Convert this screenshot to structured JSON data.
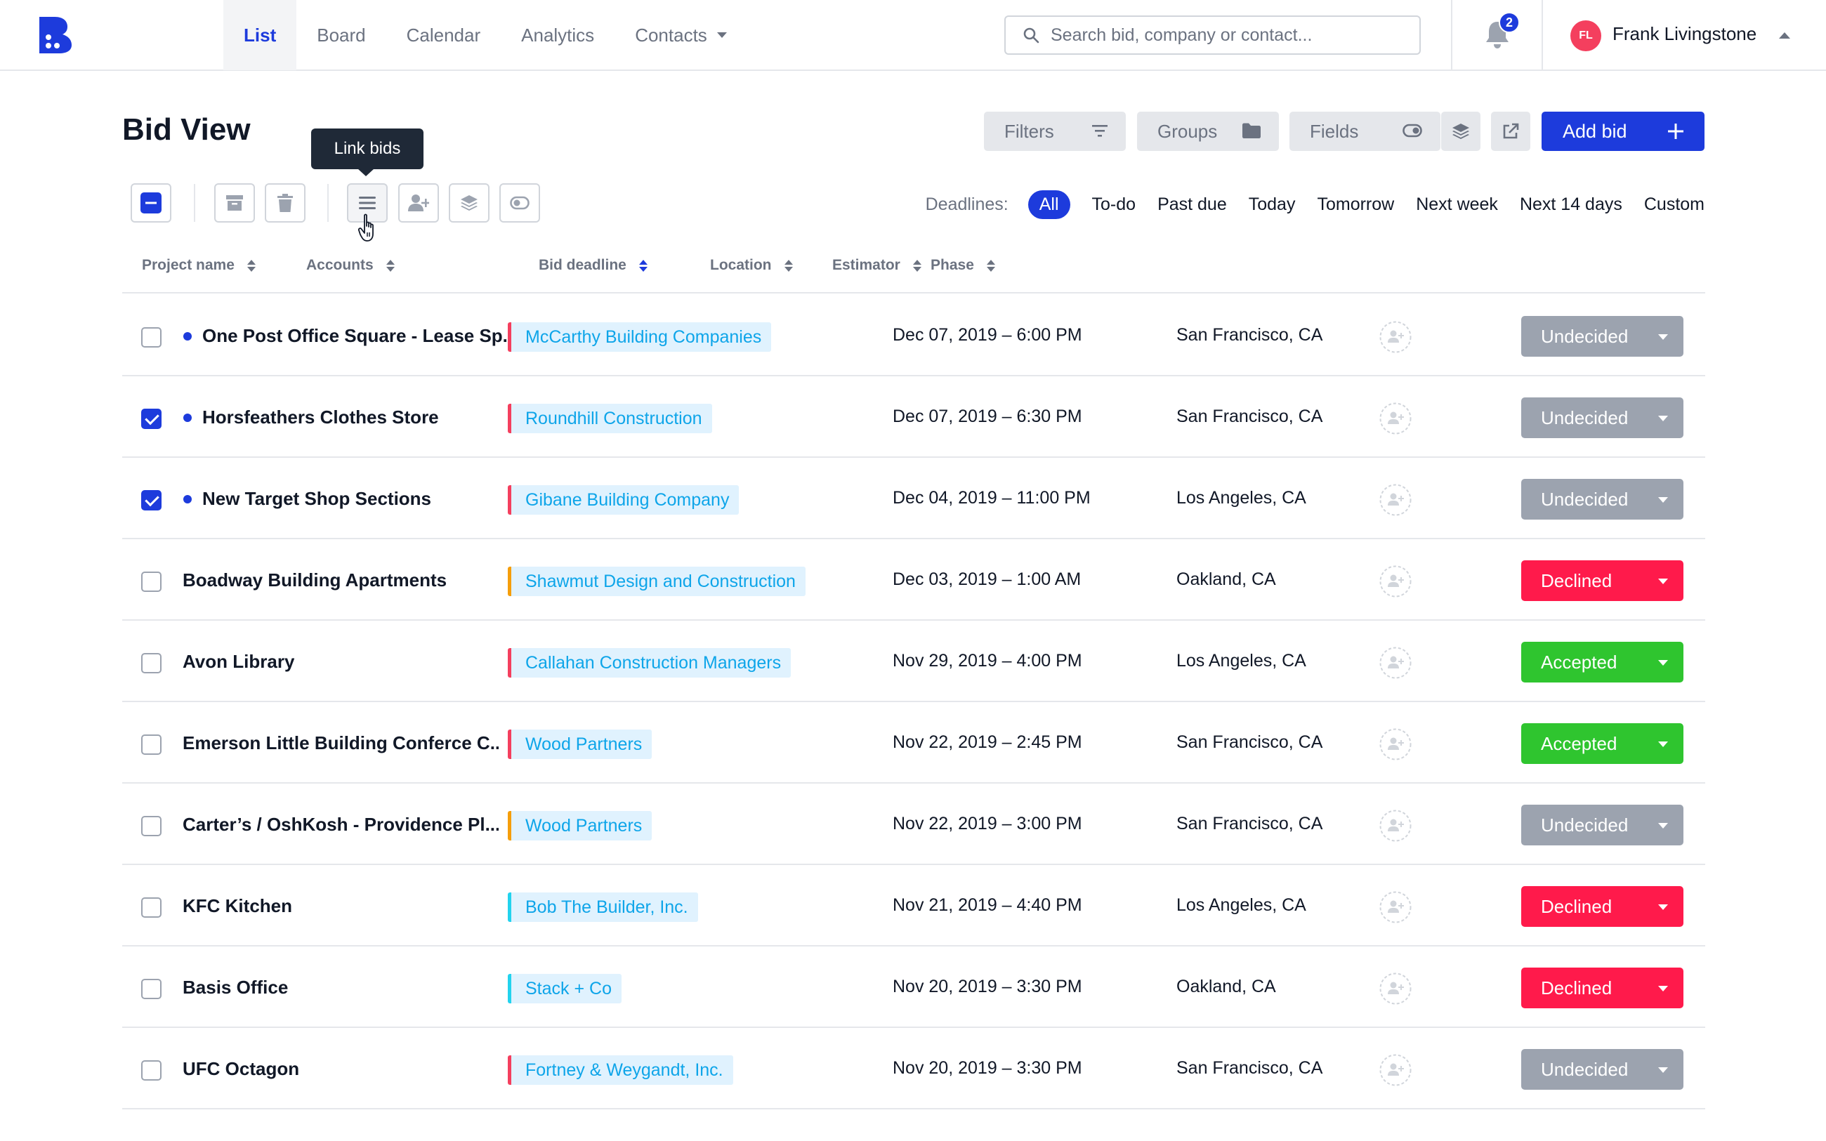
{
  "nav": {
    "tabs": [
      {
        "label": "List",
        "active": true
      },
      {
        "label": "Board"
      },
      {
        "label": "Calendar"
      },
      {
        "label": "Analytics"
      },
      {
        "label": "Contacts",
        "dropdown": true
      }
    ],
    "search_placeholder": "Search bid, company or contact...",
    "notification_count": "2",
    "user": {
      "initials": "FL",
      "name": "Frank Livingstone"
    }
  },
  "page": {
    "title": "Bid View",
    "filters_label": "Filters",
    "groups_label": "Groups",
    "fields_label": "Fields",
    "add_bid_label": "Add bid"
  },
  "toolbar": {
    "tooltip": "Link bids",
    "deadlines_label": "Deadlines:",
    "deadline_options": [
      "All",
      "To-do",
      "Past due",
      "Today",
      "Tomorrow",
      "Next week",
      "Next 14 days",
      "Custom"
    ],
    "active_deadline": "All"
  },
  "table": {
    "columns": [
      "Project name",
      "Accounts",
      "Bid deadline",
      "Location",
      "Estimator",
      "Phase"
    ],
    "rows": [
      {
        "project": "One Post Office Square - Lease Sp...",
        "new": true,
        "checked": false,
        "account": "McCarthy Building Companies",
        "account_color": "#f43f5e",
        "deadline": "Dec 07, 2019 – 6:00 PM",
        "location": "San Francisco, CA",
        "phase": "Undecided"
      },
      {
        "project": "Horsfeathers Clothes Store",
        "new": true,
        "checked": true,
        "account": "Roundhill Construction",
        "account_color": "#f43f5e",
        "deadline": "Dec 07, 2019 – 6:30 PM",
        "location": "San Francisco, CA",
        "phase": "Undecided"
      },
      {
        "project": "New Target Shop Sections",
        "new": true,
        "checked": true,
        "account": "Gibane Building Company",
        "account_color": "#f43f5e",
        "deadline": "Dec 04, 2019 – 11:00 PM",
        "location": "Los Angeles, CA",
        "phase": "Undecided"
      },
      {
        "project": "Boadway Building Apartments",
        "new": false,
        "checked": false,
        "account": "Shawmut Design and Construction",
        "account_color": "#f59e0b",
        "deadline": "Dec 03, 2019 – 1:00 AM",
        "location": "Oakland, CA",
        "phase": "Declined"
      },
      {
        "project": "Avon Library",
        "new": false,
        "checked": false,
        "account": "Callahan Construction Managers",
        "account_color": "#f43f5e",
        "deadline": "Nov 29, 2019 – 4:00 PM",
        "location": "Los Angeles, CA",
        "phase": "Accepted"
      },
      {
        "project": "Emerson Little Building Conferce C...",
        "new": false,
        "checked": false,
        "account": "Wood Partners",
        "account_color": "#f43f5e",
        "deadline": "Nov 22, 2019 – 2:45 PM",
        "location": "San Francisco, CA",
        "phase": "Accepted"
      },
      {
        "project": "Carter’s / OshKosh - Providence Pl...",
        "new": false,
        "checked": false,
        "account": "Wood Partners",
        "account_color": "#f59e0b",
        "deadline": "Nov 22, 2019 – 3:00 PM",
        "location": "San Francisco, CA",
        "phase": "Undecided"
      },
      {
        "project": "KFC Kitchen",
        "new": false,
        "checked": false,
        "account": "Bob The Builder, Inc.",
        "account_color": "#22d3ee",
        "deadline": "Nov 21, 2019 – 4:40 PM",
        "location": "Los Angeles, CA",
        "phase": "Declined"
      },
      {
        "project": "Basis Office",
        "new": false,
        "checked": false,
        "account": "Stack + Co",
        "account_color": "#22d3ee",
        "deadline": "Nov 20, 2019 – 3:30 PM",
        "location": "Oakland, CA",
        "phase": "Declined"
      },
      {
        "project": "UFC Octagon",
        "new": false,
        "checked": false,
        "account": "Fortney & Weygandt, Inc.",
        "account_color": "#f43f5e",
        "deadline": "Nov 20, 2019 – 3:30 PM",
        "location": "San Francisco, CA",
        "phase": "Undecided"
      }
    ]
  },
  "colors": {
    "accent": "#1d3bdc",
    "undecided": "#9ca3af",
    "declined": "#ff1a4b",
    "accepted": "#2fc52f"
  }
}
